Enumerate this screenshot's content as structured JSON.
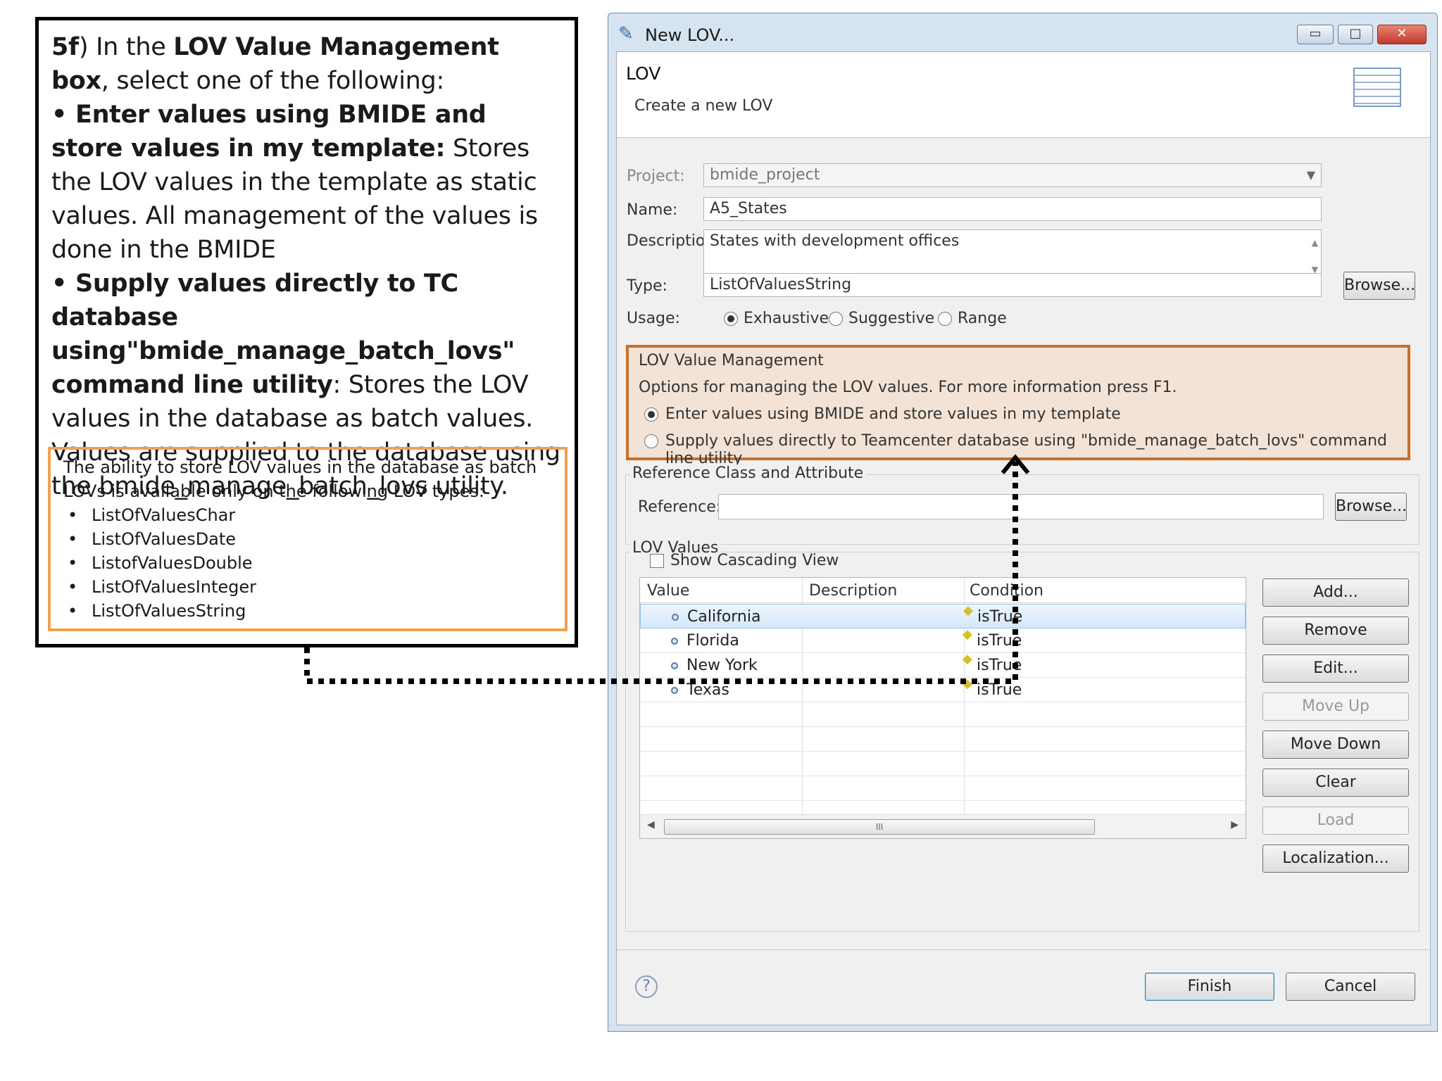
{
  "callout": {
    "step": "5f",
    "intro": ") In the ",
    "intro_bold": "LOV Value Management box",
    "intro_end": ", select one of the following:",
    "opt1_bold": "• Enter values using BMIDE and store values in my template:",
    "opt1_text": " Stores the LOV values in the template as static values. All management of the values is done in the BMIDE",
    "opt2_bold": "• Supply values directly to TC database using\"bmide_manage_batch_lovs\" command line utility",
    "opt2_text": ": Stores the LOV values in the database as batch values. Values are supplied to the database using the bmide_manage_batch_lovs utility.",
    "note_text": "The ability to store LOV values in the database as batch LOVs is available only on the following LOV types:",
    "note_types": [
      "ListOfValuesChar",
      "ListOfValuesDate",
      "ListofValuesDouble",
      "ListOfValuesInteger",
      "ListOfValuesString"
    ]
  },
  "dialog": {
    "title": "New LOV...",
    "header_title": "LOV",
    "header_subtitle": "Create a new LOV",
    "project_label": "Project:",
    "project_value": "bmide_project",
    "name_label": "Name:",
    "name_value": "A5_States",
    "description_label": "Description:",
    "description_value": "States with development offices",
    "type_label": "Type:",
    "type_value": "ListOfValuesString",
    "browse_label": "Browse...",
    "usage_label": "Usage:",
    "usage_options": [
      "Exhaustive",
      "Suggestive",
      "Range"
    ],
    "usage_selected": "Exhaustive",
    "lov_mgmt": {
      "title": "LOV Value Management",
      "info": "Options for managing the LOV values. For more information press F1.",
      "option1": "Enter values using BMIDE and store values in my template",
      "option2": "Supply values directly to Teamcenter database using \"bmide_manage_batch_lovs\" command line utility",
      "selected": "option1"
    },
    "ref_group": {
      "title": "Reference Class and Attribute",
      "reference_label": "Reference:",
      "reference_value": "",
      "browse_label": "Browse..."
    },
    "lov_values": {
      "title": "LOV Values",
      "cascading_label": "Show Cascading View",
      "cascading_checked": false,
      "columns": [
        "Value",
        "Description",
        "Condition"
      ],
      "rows": [
        {
          "value": "California",
          "description": "",
          "condition": "isTrue",
          "selected": true
        },
        {
          "value": "Florida",
          "description": "",
          "condition": "isTrue",
          "selected": false
        },
        {
          "value": "New York",
          "description": "",
          "condition": "isTrue",
          "selected": false
        },
        {
          "value": "Texas",
          "description": "",
          "condition": "isTrue",
          "selected": false
        }
      ],
      "buttons": {
        "add": "Add...",
        "remove": "Remove",
        "edit": "Edit...",
        "move_up": "Move Up",
        "move_down": "Move Down",
        "clear": "Clear",
        "load": "Load",
        "localization": "Localization..."
      }
    },
    "finish_label": "Finish",
    "cancel_label": "Cancel"
  },
  "colors": {
    "callout_border": "#000000",
    "note_border": "#f0a050",
    "highlight_border": "#c8702a",
    "highlight_fill": "#f3e3d6"
  }
}
